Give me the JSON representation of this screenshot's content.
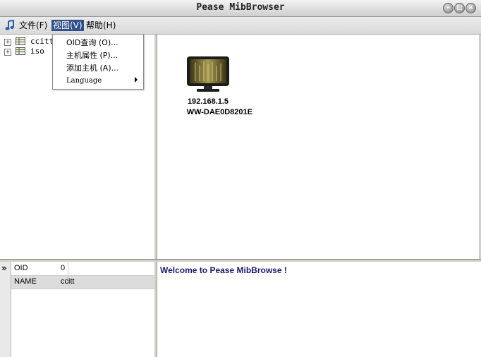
{
  "window": {
    "title": "Pease MibBrowser",
    "buttons": [
      "minimize",
      "maximize",
      "close"
    ]
  },
  "menubar": {
    "items": [
      {
        "label": "文件(F)",
        "active": false
      },
      {
        "label": "视图(V)",
        "active": true
      },
      {
        "label": "帮助(H)",
        "active": false
      }
    ]
  },
  "view_menu": {
    "items": [
      {
        "label": "OID查询 (O)..."
      },
      {
        "label": "主机属性 (P)..."
      },
      {
        "label": "添加主机 (A)..."
      },
      {
        "label": "Language",
        "has_submenu": true
      }
    ]
  },
  "tree": {
    "nodes": [
      {
        "label": "ccitt",
        "expander": "+"
      },
      {
        "label": "iso",
        "expander": "+"
      }
    ]
  },
  "hosts": [
    {
      "ip": "192.168.1.5",
      "name": "WW-DAE0D8201E"
    }
  ],
  "properties": {
    "gutter_symbol": "»",
    "rows": [
      {
        "key": "OID",
        "value": "0"
      },
      {
        "key": "NAME",
        "value": "ccitt"
      }
    ]
  },
  "console": {
    "message": "Welcome to Pease MibBrowse !"
  },
  "colors": {
    "menu_highlight": "#2e4f8a",
    "console_text": "#1a1a6e"
  }
}
